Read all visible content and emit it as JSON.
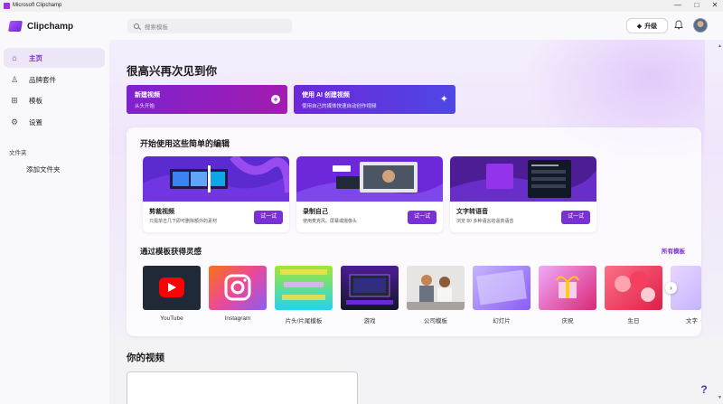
{
  "window": {
    "title": "Microsoft Clipchamp",
    "minimize": "—",
    "maximize": "□",
    "close": "✕"
  },
  "header": {
    "logo_text": "Clipchamp",
    "search_placeholder": "搜索模板",
    "upgrade_label": "升级",
    "gem_icon": "◆",
    "bell_icon": "🔔"
  },
  "sidebar": {
    "items": [
      {
        "label": "主页",
        "icon": "⌂",
        "active": true
      },
      {
        "label": "品牌套件",
        "icon": "♙",
        "active": false
      },
      {
        "label": "模板",
        "icon": "⊞",
        "active": false
      },
      {
        "label": "设置",
        "icon": "⚙",
        "active": false
      }
    ],
    "folders_label": "文件夹",
    "add_folder_label": "添加文件夹"
  },
  "main": {
    "greeting": "很高兴再次见到你",
    "cta_new": {
      "title": "新建视频",
      "subtitle": "从头开始",
      "icon": "+"
    },
    "cta_ai": {
      "title": "使用 AI 创建视频",
      "subtitle": "使用自己的媒体快速自动创作视频",
      "icon": "✦"
    },
    "panel_title": "开始使用这些简单的编辑",
    "cards": [
      {
        "title": "剪裁视频",
        "subtitle": "只需单击几下即可删除额外的素材",
        "button": "试一试"
      },
      {
        "title": "录制自己",
        "subtitle": "使用麦克风、屏幕或摄像头",
        "button": "试一试"
      },
      {
        "title": "文字转语音",
        "subtitle": "浏览 80 多种语言的逼真语音",
        "button": "试一试"
      }
    ],
    "templates_title": "通过模板获得灵感",
    "all_templates": "所有模板",
    "templates": [
      {
        "label": "YouTube"
      },
      {
        "label": "Instagram"
      },
      {
        "label": "片头/片尾模板"
      },
      {
        "label": "游戏"
      },
      {
        "label": "公司模板"
      },
      {
        "label": "幻灯片"
      },
      {
        "label": "庆祝"
      },
      {
        "label": "生日"
      },
      {
        "label": "文字"
      }
    ],
    "next_arrow": "›",
    "videos_title": "你的视频",
    "help_label": "?"
  },
  "colors": {
    "accent": "#7b2fd6",
    "cta_new": "#8e24c4",
    "cta_ai": "#5b3be0"
  }
}
